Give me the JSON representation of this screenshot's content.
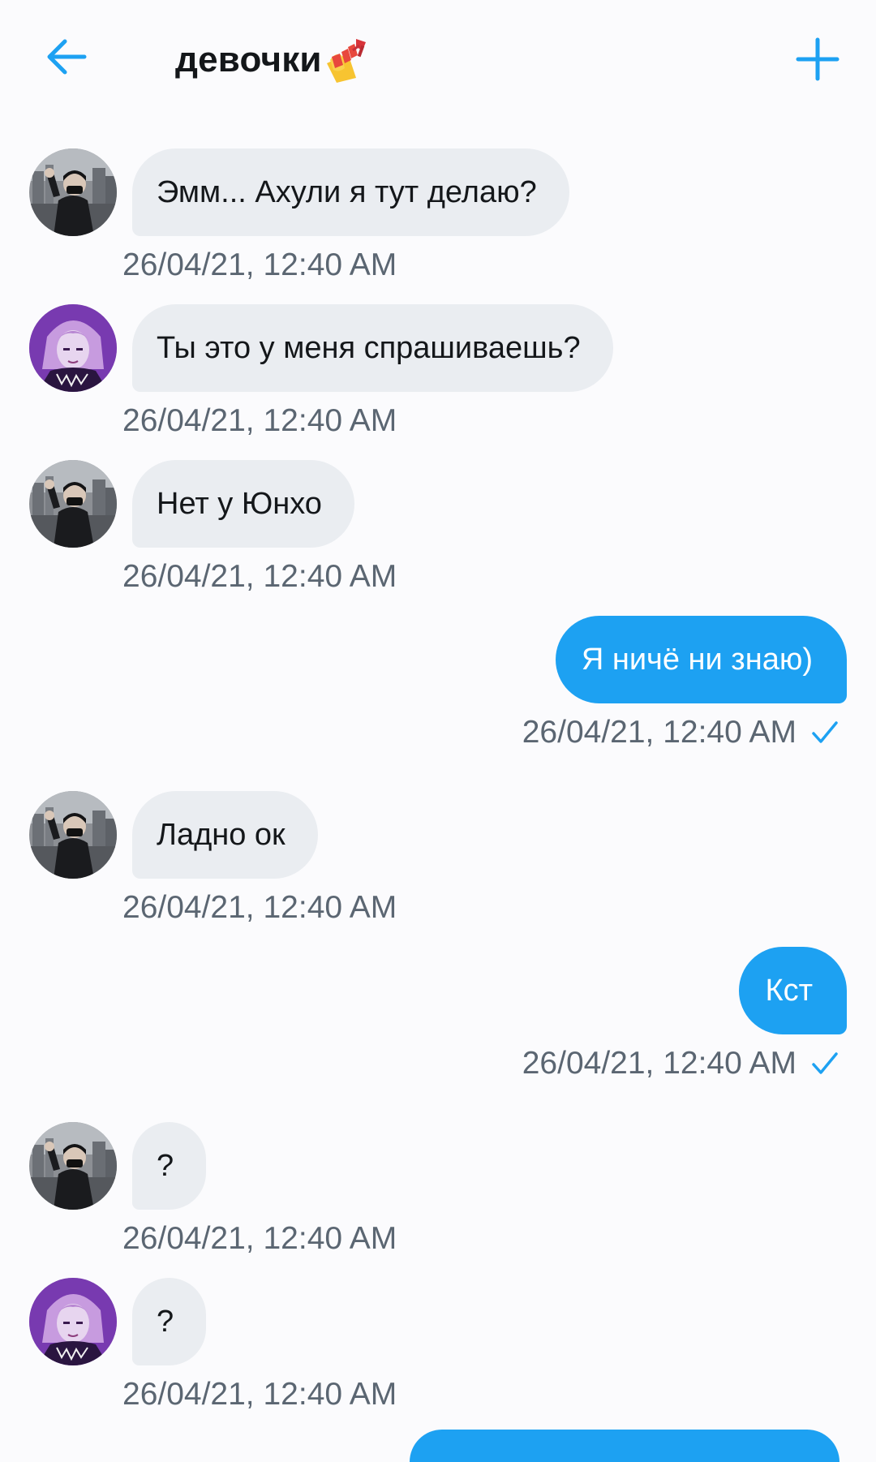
{
  "header": {
    "title": "девочки",
    "back_icon": "arrow-left-icon",
    "title_emoji": "nail-polish-icon",
    "add_icon": "plus-icon",
    "accent_color": "#1da1f2"
  },
  "messages": [
    {
      "direction": "in",
      "avatar": "avatar-dark",
      "text": "Эмм... Ахули я тут делаю?",
      "time": "26/04/21, 12:40 AM"
    },
    {
      "direction": "in",
      "avatar": "avatar-purple",
      "text": "Ты это у меня спрашиваешь?",
      "time": "26/04/21, 12:40 AM"
    },
    {
      "direction": "in",
      "avatar": "avatar-dark",
      "text": "Нет у Юнхо",
      "time": "26/04/21, 12:40 AM"
    },
    {
      "direction": "out",
      "text": "Я ничё ни знаю)",
      "time": "26/04/21, 12:40 AM",
      "status_icon": "check-icon"
    },
    {
      "direction": "in",
      "avatar": "avatar-dark",
      "text": "Ладно ок",
      "time": "26/04/21, 12:40 AM"
    },
    {
      "direction": "out",
      "text": "Кст",
      "time": "26/04/21, 12:40 AM",
      "status_icon": "check-icon"
    },
    {
      "direction": "in",
      "avatar": "avatar-dark",
      "text": "?",
      "time": "26/04/21, 12:40 AM"
    },
    {
      "direction": "in",
      "avatar": "avatar-purple",
      "text": "?",
      "time": "26/04/21, 12:40 AM"
    }
  ],
  "colors": {
    "incoming_bubble": "#eaedf1",
    "outgoing_bubble": "#1da1f2",
    "timestamp": "#5b6672"
  }
}
